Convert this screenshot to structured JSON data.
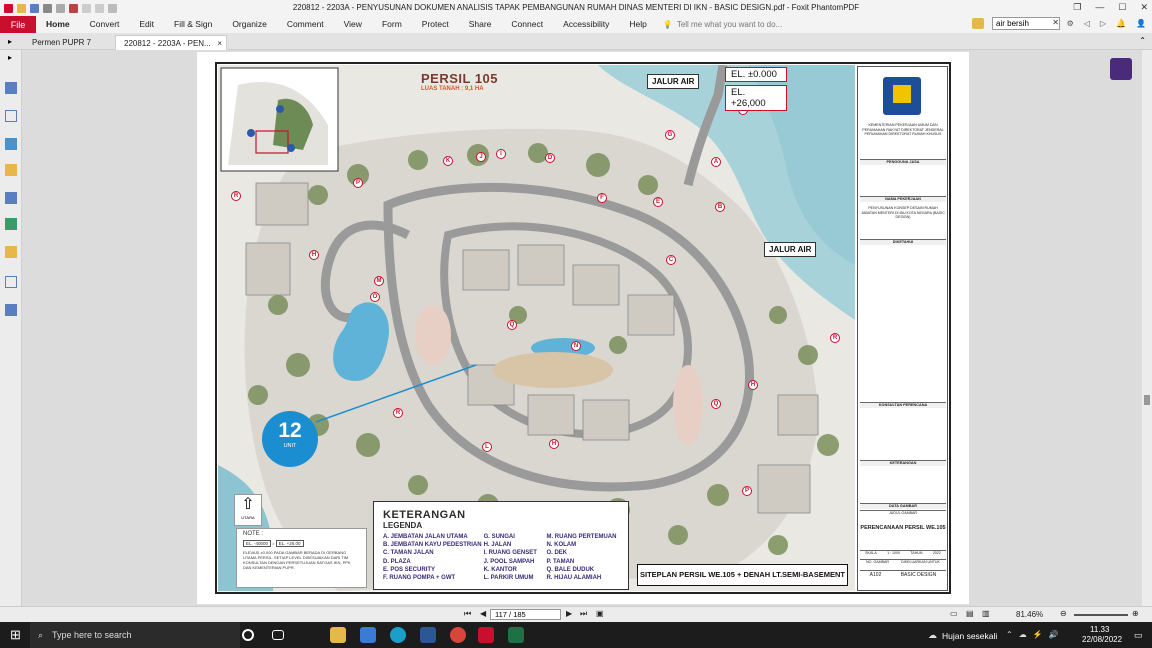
{
  "window": {
    "title": "220812 - 2203A - PENYUSUNAN DOKUMEN ANALISIS TAPAK PEMBANGUNAN RUMAH DINAS MENTERI DI IKN - BASIC DESIGN.pdf - Foxit PhantomPDF"
  },
  "ribbon": {
    "file": "File",
    "menu": [
      "Home",
      "Convert",
      "Edit",
      "Fill & Sign",
      "Organize",
      "Comment",
      "View",
      "Form",
      "Protect",
      "Share",
      "Connect",
      "Accessibility",
      "Help"
    ],
    "tell_me": "Tell me what you want to do...",
    "search_value": "air bersih"
  },
  "tabs": [
    {
      "label": "Permen PUPR 7 Tahu..."
    },
    {
      "label": "220812 - 2203A - PEN...",
      "close": "×"
    }
  ],
  "drawing": {
    "persil_title": "PERSIL 105",
    "persil_sub": "LUAS TANAH : 9,1 HA",
    "jalur_air_1": "JALUR AIR",
    "jalur_air_2": "JALUR AIR",
    "el_top": "EL. ±0.000",
    "el_bottom": "EL. +26,000",
    "unit_count": "12",
    "unit_label": "UNIT",
    "north_label": "UTARA",
    "note_title": "NOTE :",
    "note_el_1": "EL. -40000",
    "note_el_2": "EL. +26.00",
    "note_text": "ELEVASI ±0.000 PADA GAMBAR BERADA DI GERBANG UTAMA PERSIL. SETIAP LEVEL DISESUAIKAN DARI TIM KONSULTAN DENGAN PERSETUJUAN SATGAS IKN, PPK DAN KEMENTERIAN PUPR.",
    "siteplan_caption": "SITEPLAN PERSIL WE.105 + DENAH LT.SEMI-BASEMENT",
    "legend": {
      "title": "KETERANGAN",
      "subtitle": "LEGENDA",
      "col1": [
        "A. JEMBATAN JALAN UTAMA",
        "B. JEMBATAN KAYU PEDESTRIAN",
        "C. TAMAN JALAN",
        "D. PLAZA",
        "E. POS SECURITY",
        "F. RUANG POMPA + GWT"
      ],
      "col2": [
        "G. SUNGAI",
        "H. JALAN",
        "I. RUANG GENSET",
        "J. POOL SAMPAH",
        "K. KANTOR",
        "L. PARKIR UMUM"
      ],
      "col3": [
        "M. RUANG PERTEMUAN",
        "N. KOLAM",
        "O. DEK",
        "P. TAMAN",
        "Q. BALE DUDUK",
        "R. HIJAU ALAMIAH"
      ]
    },
    "title_block": {
      "ministry": "KEMENTERIAN PEKERJAAN UMUM DAN PERUMAHAN RAKYAT DIREKTORAT JENDERAL PERUMAHAN DIREKTORAT RUMAH KHUSUS",
      "pengguna_jasa": "PENGGUNA JASA",
      "nama_pekerjaan": "NAMA PEKERJAAN",
      "pekerjaan": "PENYUSUNAN KONSEP DESAIN RUMAH JABATAN MENTERI DI IBU KOTA NEGARA (BASIC DESIGN)",
      "diketahui": "DIKETAHUI",
      "konsultan": "KONSULTAN PERENCANA",
      "keterangan": "KETERANGAN",
      "data_gambar": "DATA GAMBAR",
      "judul_gambar": "JUDUL GAMBAR",
      "judul": "PERENCANAAN PERSIL WE.105",
      "skala_label": "SKALA",
      "skala": "1 : 1000",
      "tahun_label": "TAHUN",
      "tahun": "2022",
      "no_gambar": "NO. GAMBAR",
      "diajukan": "DIKELUARKAN UNTUK",
      "code": "A102",
      "basic": "BASIC DESIGN"
    }
  },
  "status": {
    "page": "117 / 185",
    "zoom": "81.46%"
  },
  "taskbar": {
    "search": "Type here to search",
    "weather": "Hujan sesekali",
    "time": "11.33",
    "date": "22/08/2022"
  }
}
